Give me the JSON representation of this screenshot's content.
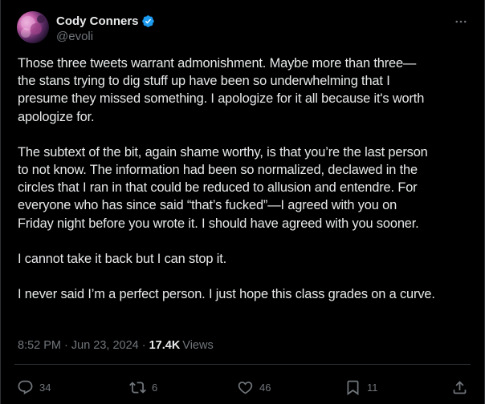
{
  "author": {
    "display_name": "Cody Conners",
    "handle": "@evoli",
    "verified": true,
    "avatar_icon": "avatar-image"
  },
  "tweet": {
    "paragraphs": [
      "Those three tweets warrant admonishment. Maybe more than three—\nthe stans trying to dig stuff up have been so underwhelming that I\npresume they missed something. I apologize for it all because it's worth\napologize for.",
      "The subtext of the bit, again shame worthy, is that you’re the last person\nto not know. The information had been so normalized, declawed in the\ncircles that I ran in that could be reduced to allusion and entendre. For\neveryone who has since said “that’s fucked”—I agreed with you on\nFriday night before you wrote it. I should have agreed with you sooner.",
      "I cannot take it back but I can stop it.",
      "I never said I’m a perfect person. I just hope this class grades on a curve."
    ],
    "timestamp": "8:52 PM · Jun 23, 2024",
    "separator": "·",
    "views_count": "17.4K",
    "views_label": "Views"
  },
  "actions": {
    "replies": "34",
    "reposts": "6",
    "likes": "46",
    "bookmarks": "11"
  },
  "colors": {
    "background": "#000000",
    "text": "#e7e9ea",
    "secondary": "#71767b",
    "verified_blue": "#1d9bf0",
    "divider": "#2f3336"
  }
}
